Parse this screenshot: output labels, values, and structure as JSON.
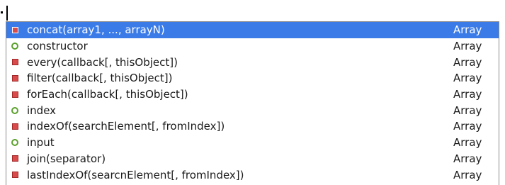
{
  "completion": {
    "items": [
      {
        "signature": "concat(array1, ..., arrayN)",
        "owner": "Array",
        "kind": "method",
        "icon": "method-icon",
        "selected": true
      },
      {
        "signature": "constructor",
        "owner": "Array",
        "kind": "field",
        "icon": "field-icon",
        "selected": false
      },
      {
        "signature": "every(callback[, thisObject])",
        "owner": "Array",
        "kind": "method",
        "icon": "method-icon",
        "selected": false
      },
      {
        "signature": "filter(callback[, thisObject])",
        "owner": "Array",
        "kind": "method",
        "icon": "method-icon",
        "selected": false
      },
      {
        "signature": "forEach(callback[, thisObject])",
        "owner": "Array",
        "kind": "method",
        "icon": "method-icon",
        "selected": false
      },
      {
        "signature": "index",
        "owner": "Array",
        "kind": "field",
        "icon": "field-icon",
        "selected": false
      },
      {
        "signature": "indexOf(searchElement[, fromIndex])",
        "owner": "Array",
        "kind": "method",
        "icon": "method-icon",
        "selected": false
      },
      {
        "signature": "input",
        "owner": "Array",
        "kind": "field",
        "icon": "field-icon",
        "selected": false
      },
      {
        "signature": "join(separator)",
        "owner": "Array",
        "kind": "method",
        "icon": "method-icon",
        "selected": false
      },
      {
        "signature": "lastIndexOf(searcnElement[, fromIndex])",
        "owner": "Array",
        "kind": "method",
        "icon": "method-icon",
        "selected": false
      }
    ]
  },
  "colors": {
    "selection": "#3a7be8",
    "method_icon": "#d94b4b",
    "field_icon": "#5aa02c",
    "border": "#8c8c8c"
  }
}
